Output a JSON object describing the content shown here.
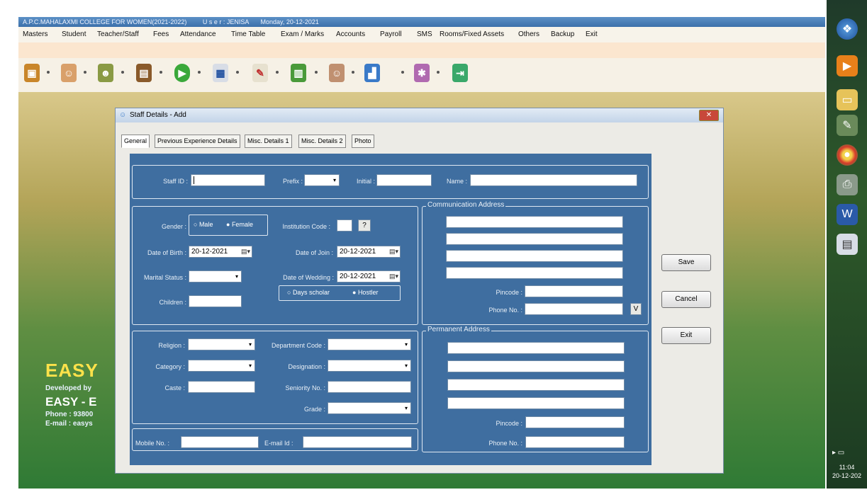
{
  "window": {
    "title": "A.P.C.MAHALAXMI COLLEGE FOR WOMEN(2021-2022)",
    "user": "U s e r : JENISA",
    "date": "Monday, 20-12-2021"
  },
  "menu": [
    "Masters",
    "Student",
    "Teacher/Staff",
    "Fees",
    "Attendance",
    "Time Table",
    "Exam / Marks",
    "Accounts",
    "Payroll",
    "SMS",
    "Rooms/Fixed Assets",
    "Others",
    "Backup",
    "Exit"
  ],
  "toolbar_icons": [
    "gift-icon",
    "users-icon",
    "people-icon",
    "books-icon",
    "play-icon",
    "calendar-icon",
    "edit-icon",
    "reader-icon",
    "person-icon",
    "chart-icon",
    "settings-icon",
    "exit-door-icon"
  ],
  "brand": {
    "name": "EASY",
    "developed_by": "Developed by",
    "company": "EASY - E",
    "phone": "Phone : 93800",
    "email": "E-mail : easys"
  },
  "dialog": {
    "title": "Staff Details - Add",
    "tabs": [
      "General",
      "Previous Experience Details",
      "Misc. Details 1",
      "Misc. Details 2",
      "Photo"
    ],
    "labels": {
      "staff_id": "Staff ID :",
      "prefix": "Prefix :",
      "initial": "Initial :",
      "name": "Name :",
      "gender": "Gender :",
      "male": "Male",
      "female": "Female",
      "institution_code": "Institution Code :",
      "help": "?",
      "dob": "Date of Birth :",
      "doj": "Date of Join :",
      "marital_status": "Marital Status :",
      "dow": "Date of Wedding :",
      "days_scholar": "Days scholar",
      "hostler": "Hostler",
      "children": "Children :",
      "comm_address": "Communication Address",
      "pincode": "Pincode :",
      "phone_no": "Phone No. :",
      "v_button": "V",
      "religion": "Religion :",
      "department_code": "Department Code :",
      "category": "Category :",
      "designation": "Designation :",
      "caste": "Caste :",
      "seniority_no": "Seniority No. :",
      "grade": "Grade :",
      "perm_address": "Permanent Address",
      "mobile_no": "Mobile No. :",
      "email_id": "E-mail Id :"
    },
    "values": {
      "dob": "20-12-2021",
      "doj": "20-12-2021",
      "dow": "20-12-2021"
    },
    "buttons": {
      "save": "Save",
      "cancel": "Cancel",
      "exit": "Exit"
    }
  },
  "taskbar": {
    "time": "11:04",
    "date": "20-12-202"
  }
}
